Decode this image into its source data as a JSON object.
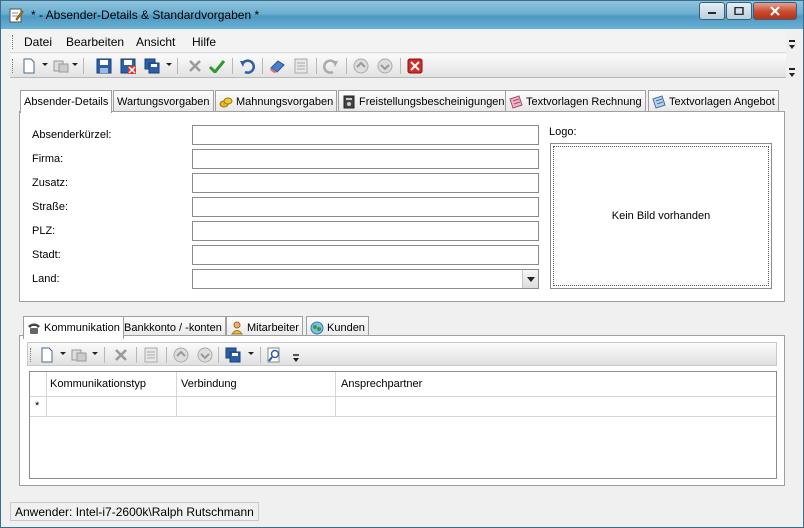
{
  "window": {
    "title": "* - Absender-Details & Standardvorgaben *"
  },
  "menubar": {
    "items": [
      "Datei",
      "Bearbeiten",
      "Ansicht",
      "Hilfe"
    ]
  },
  "toolbar": {
    "icons": [
      "new-icon",
      "copy-icon",
      "save-icon",
      "save-close-icon",
      "save-as-icon",
      "cancel-icon",
      "confirm-icon",
      "undo-icon",
      "erase-icon",
      "list-icon",
      "redo-icon",
      "up-icon",
      "down-icon",
      "close-red-icon"
    ]
  },
  "tabs": {
    "main": [
      {
        "label": "Absender-Details",
        "icon": ""
      },
      {
        "label": "Wartungsvorgaben",
        "icon": ""
      },
      {
        "label": "Mahnungsvorgaben",
        "icon": "coins-icon"
      },
      {
        "label": "Freistellungsbescheinigungen",
        "icon": "certificate-icon"
      },
      {
        "label": "Textvorlagen Rechnung",
        "icon": "note-pink-icon"
      },
      {
        "label": "Textvorlagen Angebot",
        "icon": "note-blue-icon"
      }
    ],
    "sub": [
      {
        "label": "Kommunikation",
        "icon": "phone-icon"
      },
      {
        "label": "Bankkonto / -konten",
        "icon": ""
      },
      {
        "label": "Mitarbeiter",
        "icon": "person-icon"
      },
      {
        "label": "Kunden",
        "icon": "customers-icon"
      }
    ]
  },
  "form": {
    "absenderkuerzel": {
      "label": "Absenderkürzel:",
      "value": ""
    },
    "firma": {
      "label": "Firma:",
      "value": ""
    },
    "zusatz": {
      "label": "Zusatz:",
      "value": ""
    },
    "strasse": {
      "label": "Straße:",
      "value": ""
    },
    "plz": {
      "label": "PLZ:",
      "value": ""
    },
    "stadt": {
      "label": "Stadt:",
      "value": ""
    },
    "land": {
      "label": "Land:",
      "value": ""
    }
  },
  "logo": {
    "label": "Logo:",
    "placeholder": "Kein Bild vorhanden"
  },
  "grid": {
    "columns": [
      "Kommunikationstyp",
      "Verbindung",
      "Ansprechpartner"
    ],
    "new_row_marker": "*"
  },
  "status": {
    "user": "Anwender: Intel-i7-2600k\\Ralph Rutschmann"
  },
  "colors": {
    "titlebar": "#6aaed0",
    "close_button": "#c74a2f",
    "panel_border": "#a0a0a0"
  }
}
